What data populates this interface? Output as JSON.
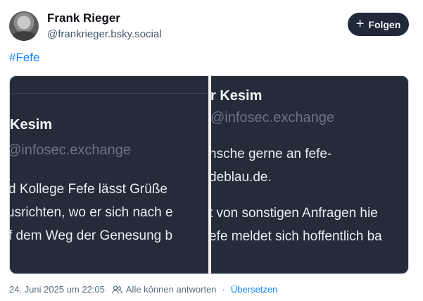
{
  "author": {
    "name": "Frank Rieger",
    "handle": "@frankrieger.bsky.social"
  },
  "follow_button": {
    "icon": "plus-icon",
    "label": "Folgen"
  },
  "post": {
    "hashtag": "#Fefe"
  },
  "image": {
    "left_panel": {
      "name_fragment": "Kesim",
      "handle_fragment": "@infosec.exchange",
      "lines": [
        "d Kollege Fefe lässt Grüße",
        "usrichten, wo er sich nach e",
        "f dem Weg der Genesung b"
      ]
    },
    "right_panel": {
      "name_fragment": "r Kesim",
      "handle_fragment": "@infosec.exchange",
      "lines": [
        "nsche gerne an fefe-",
        "deblau.de.",
        "t von sonstigen Anfragen hie",
        "efe meldet sich hoffentlich ba"
      ]
    }
  },
  "footer": {
    "timestamp": "24. Juni 2025 um 22:05",
    "reply_icon": "people-icon",
    "reply_setting": "Alle können antworten",
    "separator": "·",
    "translate": "Übersetzen"
  }
}
